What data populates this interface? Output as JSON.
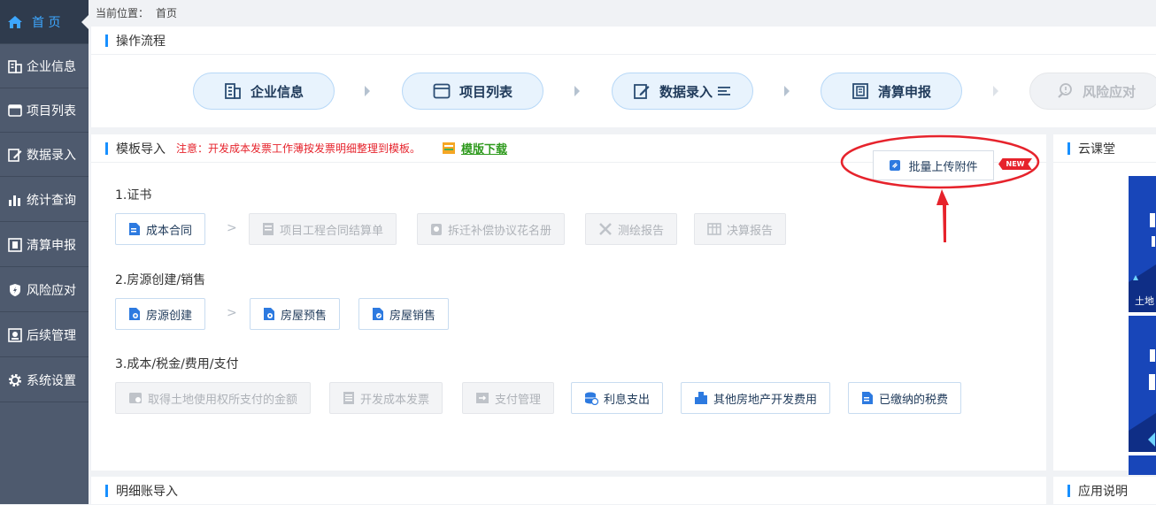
{
  "sidebar": {
    "items": [
      {
        "label": "首 页",
        "icon": "home-icon",
        "active": true
      },
      {
        "label": "企业信息",
        "icon": "building-icon"
      },
      {
        "label": "项目列表",
        "icon": "list-icon"
      },
      {
        "label": "数据录入",
        "icon": "edit-icon"
      },
      {
        "label": "统计查询",
        "icon": "bar-chart-icon"
      },
      {
        "label": "清算申报",
        "icon": "report-icon"
      },
      {
        "label": "风险应对",
        "icon": "shield-icon"
      },
      {
        "label": "后续管理",
        "icon": "manage-icon"
      },
      {
        "label": "系统设置",
        "icon": "gear-icon"
      }
    ]
  },
  "breadcrumb": {
    "prefix": "当前位置：",
    "current": "首页"
  },
  "flow": {
    "title": "操作流程",
    "steps": [
      {
        "label": "企业信息",
        "icon": "building-icon"
      },
      {
        "label": "项目列表",
        "icon": "window-icon"
      },
      {
        "label": "数据录入",
        "icon": "edit-icon"
      },
      {
        "label": "清算申报",
        "icon": "report-icon"
      },
      {
        "label": "风险应对",
        "icon": "risk-icon",
        "disabled": true
      }
    ]
  },
  "template": {
    "title": "模板导入",
    "notice": "注意：开发成本发票工作薄按发票明细整理到模板。",
    "download": "模版下载",
    "upload_label": "批量上传附件",
    "new_badge": "NEW",
    "sections": [
      {
        "title": "1.证书",
        "buttons": [
          {
            "label": "成本合同",
            "disabled": false
          },
          {
            "label": "项目工程合同结算单",
            "disabled": true
          },
          {
            "label": "拆迁补偿协议花名册",
            "disabled": true
          },
          {
            "label": "测绘报告",
            "disabled": true
          },
          {
            "label": "决算报告",
            "disabled": true
          }
        ]
      },
      {
        "title": "2.房源创建/销售",
        "buttons": [
          {
            "label": "房源创建",
            "disabled": false
          },
          {
            "label": "房屋预售",
            "disabled": false
          },
          {
            "label": "房屋销售",
            "disabled": false
          }
        ]
      },
      {
        "title": "3.成本/税金/费用/支付",
        "buttons": [
          {
            "label": "取得土地使用权所支付的金额",
            "disabled": true
          },
          {
            "label": "开发成本发票",
            "disabled": true
          },
          {
            "label": "支付管理",
            "disabled": true
          },
          {
            "label": "利息支出",
            "disabled": false
          },
          {
            "label": "其他房地产开发费用",
            "disabled": false
          },
          {
            "label": "已缴纳的税费",
            "disabled": false
          }
        ]
      }
    ]
  },
  "cloud": {
    "title": "云课堂",
    "card1_text": "土地"
  },
  "detail": {
    "title": "明细账导入"
  },
  "app_help": {
    "title": "应用说明"
  },
  "colors": {
    "accent": "#1890ff",
    "sidebar_bg": "#4e5a6e",
    "notice": "#e6232c",
    "download": "#2f9a1e",
    "annotation": "#e6232c"
  }
}
